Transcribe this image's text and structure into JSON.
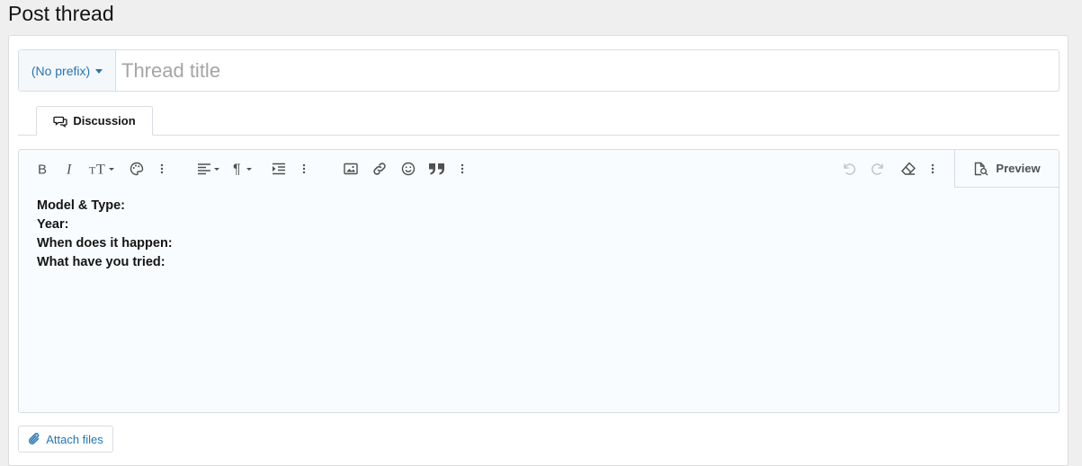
{
  "page": {
    "title": "Post thread"
  },
  "form": {
    "prefix_label": "(No prefix)",
    "title_placeholder": "Thread title",
    "title_value": ""
  },
  "tabs": [
    {
      "label": "Discussion"
    }
  ],
  "toolbar": {
    "left_icons": [
      "bold-icon",
      "italic-icon",
      "font-size-icon",
      "palette-icon",
      "more-icon",
      "align-icon",
      "paragraph-icon",
      "indent-icon",
      "more-icon",
      "image-icon",
      "link-icon",
      "smiley-icon",
      "quote-icon",
      "more-icon"
    ],
    "right_icons": [
      "undo-icon",
      "redo-icon",
      "eraser-icon",
      "more-icon"
    ],
    "preview_label": "Preview"
  },
  "editor": {
    "lines": [
      "Model & Type:",
      "Year:",
      "When does it happen:",
      "What have you tried:"
    ]
  },
  "attach": {
    "label": "Attach files"
  },
  "colors": {
    "accent": "#2577b1",
    "editor_bg": "#f9fcfe",
    "border": "#d8dde3"
  }
}
